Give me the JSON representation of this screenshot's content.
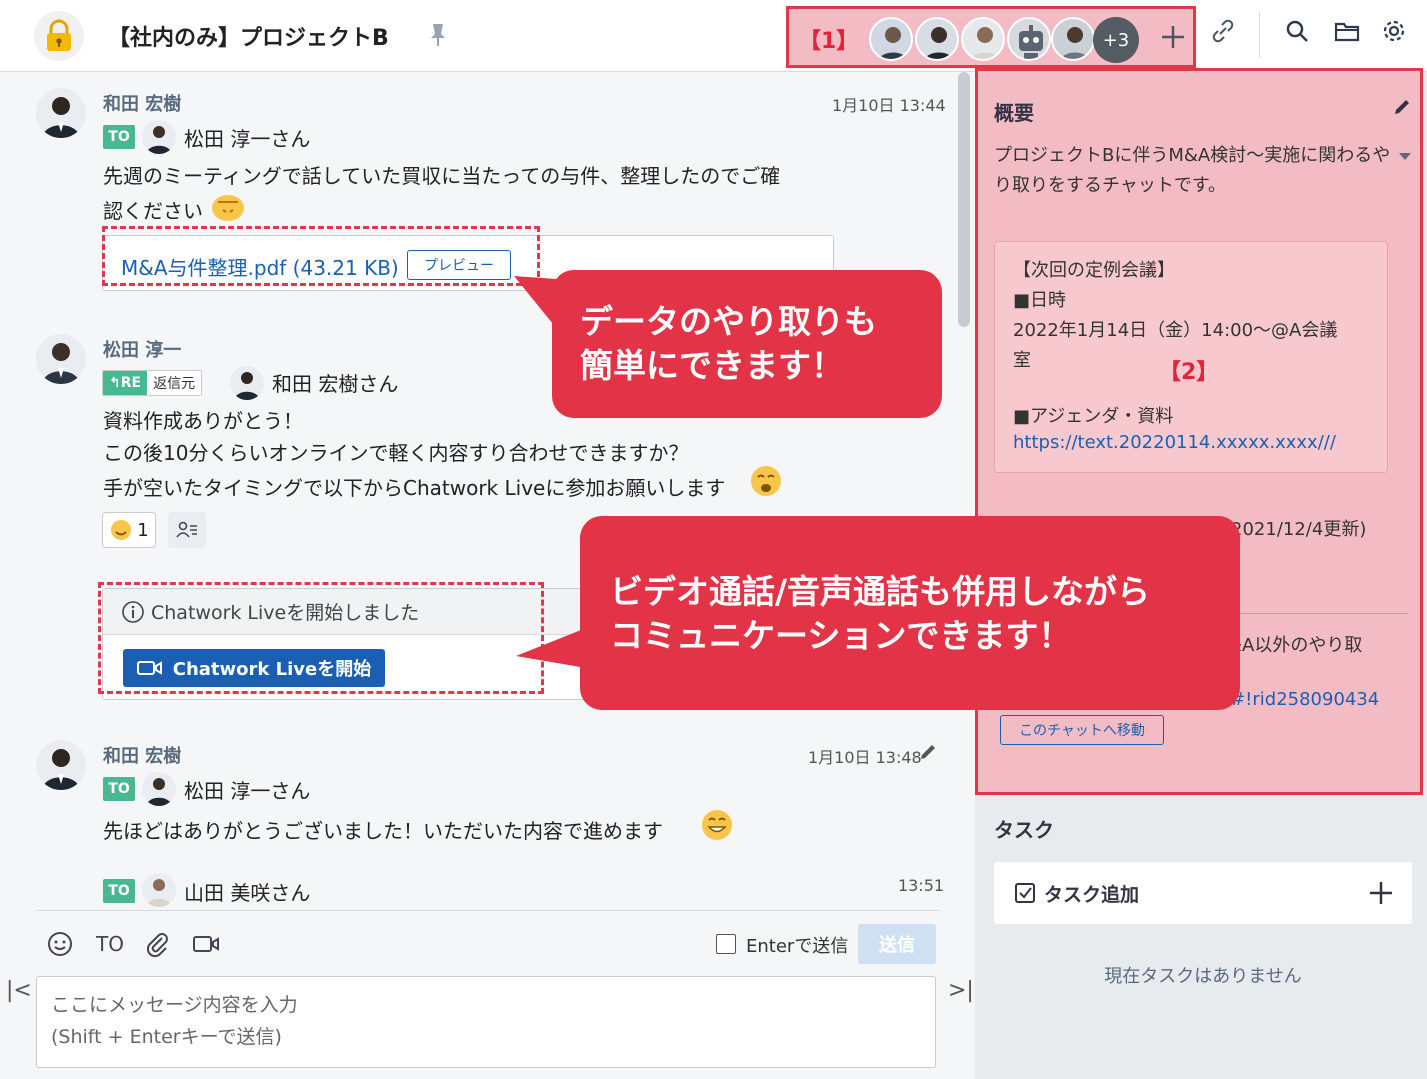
{
  "header": {
    "room_title": "【社内のみ】プロジェクトB",
    "member_box_label": "【1】",
    "members_extra": "+3"
  },
  "messages": [
    {
      "sender": "和田 宏樹",
      "time": "1月10日 13:44",
      "to_badge": "TO",
      "to_name": "松田 淳一さん",
      "lines": [
        "先週のミーティングで話していた買収に当たっての与件、整理したのでご確",
        "認ください"
      ],
      "file_name": "M&A与件整理.pdf (43.21 KB)",
      "preview_label": "プレビュー"
    },
    {
      "sender": "松田 淳一",
      "re_label": "RE",
      "re_source": "返信元",
      "to_name": "和田 宏樹さん",
      "lines": [
        "資料作成ありがとう！",
        "この後10分くらいオンラインで軽く内容すり合わせできますか？",
        "手が空いたタイミングで以下からChatwork Liveに参加お願いします"
      ],
      "reaction_count": "1",
      "live_notice": "Chatwork Liveを開始しました",
      "live_button": "Chatwork Liveを開始"
    },
    {
      "sender": "和田 宏樹",
      "time": "1月10日 13:48",
      "to_badge": "TO",
      "to_name": "松田 淳一さん",
      "lines": [
        "先ほどはありがとうございました！いただいた内容で進めます"
      ]
    },
    {
      "time": "13:51",
      "to_badge": "TO",
      "to_name": "山田 美咲さん"
    }
  ],
  "callouts": [
    {
      "lines": [
        "データのやり取りも",
        "簡単にできます！"
      ]
    },
    {
      "lines": [
        "ビデオ通話/音声通話も併用しながら",
        "コミュニケーションできます！"
      ]
    }
  ],
  "composer": {
    "to_label": "TO",
    "enter_send_label": "Enterで送信",
    "send_label": "送信",
    "placeholder": "ここにメッセージ内容を入力\n(Shift + Enterキーで送信)"
  },
  "summary": {
    "box_label": "【2】",
    "title": "概要",
    "desc": "プロジェクトBに伴うM&A検討〜実施に関わるやり取りをするチャットです。",
    "card_lines": [
      "【次回の定例会議】",
      "■日時",
      "2022年1月14日（金）14:00〜@A会議",
      "室",
      "■アジェンダ・資料"
    ],
    "card_link": "https://text.20220114.xxxxx.xxxx///",
    "partial_1": "(2021/12/4更新)",
    "partial_2": "&A以外のやり取",
    "partial_3": "/#!rid258090434",
    "move_button": "このチャットへ移動"
  },
  "tasks": {
    "title": "タスク",
    "add_label": "タスク追加",
    "empty_label": "現在タスクはありません"
  },
  "colors": {
    "accent_red": "#e23446",
    "link_blue": "#1a5fb4",
    "to_green": "#47b88f"
  }
}
